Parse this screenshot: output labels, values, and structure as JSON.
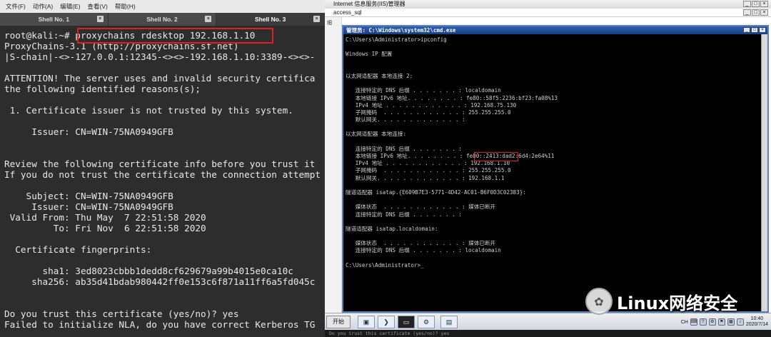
{
  "terminal": {
    "menu": [
      "文件(F)",
      "动作(A)",
      "编辑(E)",
      "查看(V)",
      "帮助(H)"
    ],
    "tabs": [
      {
        "label": "Shell No. 1",
        "active": false
      },
      {
        "label": "Shell No. 2",
        "active": false
      },
      {
        "label": "Shell No. 3",
        "active": true
      }
    ],
    "lines": [
      "root@kali:~# proxychains rdesktop 192.168.1.10",
      "ProxyChains-3.1 (http://proxychains.sf.net)",
      "|S-chain|-<>-127.0.0.1:12345-<><>-192.168.1.10:3389-<><>-",
      "",
      "ATTENTION! The server uses and invalid security certifica",
      "the following identified reasons(s);",
      "",
      " 1. Certificate issuer is not trusted by this system.",
      "",
      "     Issuer: CN=WIN-75NA0949GFB",
      "",
      "",
      "Review the following certificate info before you trust it",
      "If you do not trust the certificate the connection attempt",
      "",
      "    Subject: CN=WIN-75NA0949GFB",
      "     Issuer: CN=WIN-75NA0949GFB",
      " Valid From: Thu May  7 22:51:58 2020",
      "         To: Fri Nov  6 22:51:58 2020",
      "",
      "  Certificate fingerprints:",
      "",
      "       sha1: 3ed8023cbbb1dedd8cf629679a99b4015e0ca10c",
      "     sha256: ab35d41bdab980442ff0e153c6f871a11ff6a5fd045c",
      "",
      "",
      "Do you trust this certificate (yes/no)? yes",
      "Failed to initialize NLA, do you have correct Kerberos TG"
    ]
  },
  "vm": {
    "outer_title": "Internet 信息服务(IIS)管理器",
    "inner_title": "access_sql",
    "window_buttons": [
      "_",
      "□",
      "×"
    ],
    "side_labels": [
      "细",
      "",
      "",
      "",
      "",
      "",
      "",
      "",
      "",
      ""
    ],
    "cmd": {
      "title": "管理员: C:\\Windows\\system32\\cmd.exe",
      "lines": [
        "C:\\Users\\Administrator>ipconfig",
        "",
        "Windows IP 配置",
        "",
        "",
        "以太网适配器 本地连接 2:",
        "",
        "   连接特定的 DNS 后缀 . . . . . . . : localdomain",
        "   本地链接 IPv6 地址. . . . . . . . : fe80::58f5:2236:bf23:fa08%13",
        "   IPv4 地址 . . . . . . . . . . . . : 192.168.75.130",
        "   子网掩码  . . . . . . . . . . . . : 255.255.255.0",
        "   默认网关. . . . . . . . . . . . . :",
        "",
        "以太网适配器 本地连接:",
        "",
        "   连接特定的 DNS 后缀 . . . . . . . :",
        "   本地链接 IPv6 地址. . . . . . . . : fe80::2413:dad2:6d4:2e64%11",
        "   IPv4 地址 . . . . . . . . . . . . : 192.168.1.10",
        "   子网掩码  . . . . . . . . . . . . : 255.255.255.0",
        "   默认网关. . . . . . . . . . . . . : 192.168.1.1",
        "",
        "隧道适配器 isatap.{E609B7E3-5771-4D42-AC01-B6F0D3C02383}:",
        "",
        "   媒体状态  . . . . . . . . . . . . : 媒体已断开",
        "   连接特定的 DNS 后缀 . . . . . . . :",
        "",
        "隧道适配器 isatap.localdomain:",
        "",
        "   媒体状态  . . . . . . . . . . . . : 媒体已断开",
        "   连接特定的 DNS 后缀 . . . . . . . : localdomain",
        "",
        "C:\\Users\\Administrator>_"
      ]
    },
    "taskbar": {
      "start_label": "开始",
      "lang": "CH",
      "time": "10:40",
      "date": "2020/7/14"
    },
    "bottom_strip": "Do you trust this certificate (yes/no)? yes"
  },
  "watermark": {
    "text": "Linux网络安全"
  }
}
